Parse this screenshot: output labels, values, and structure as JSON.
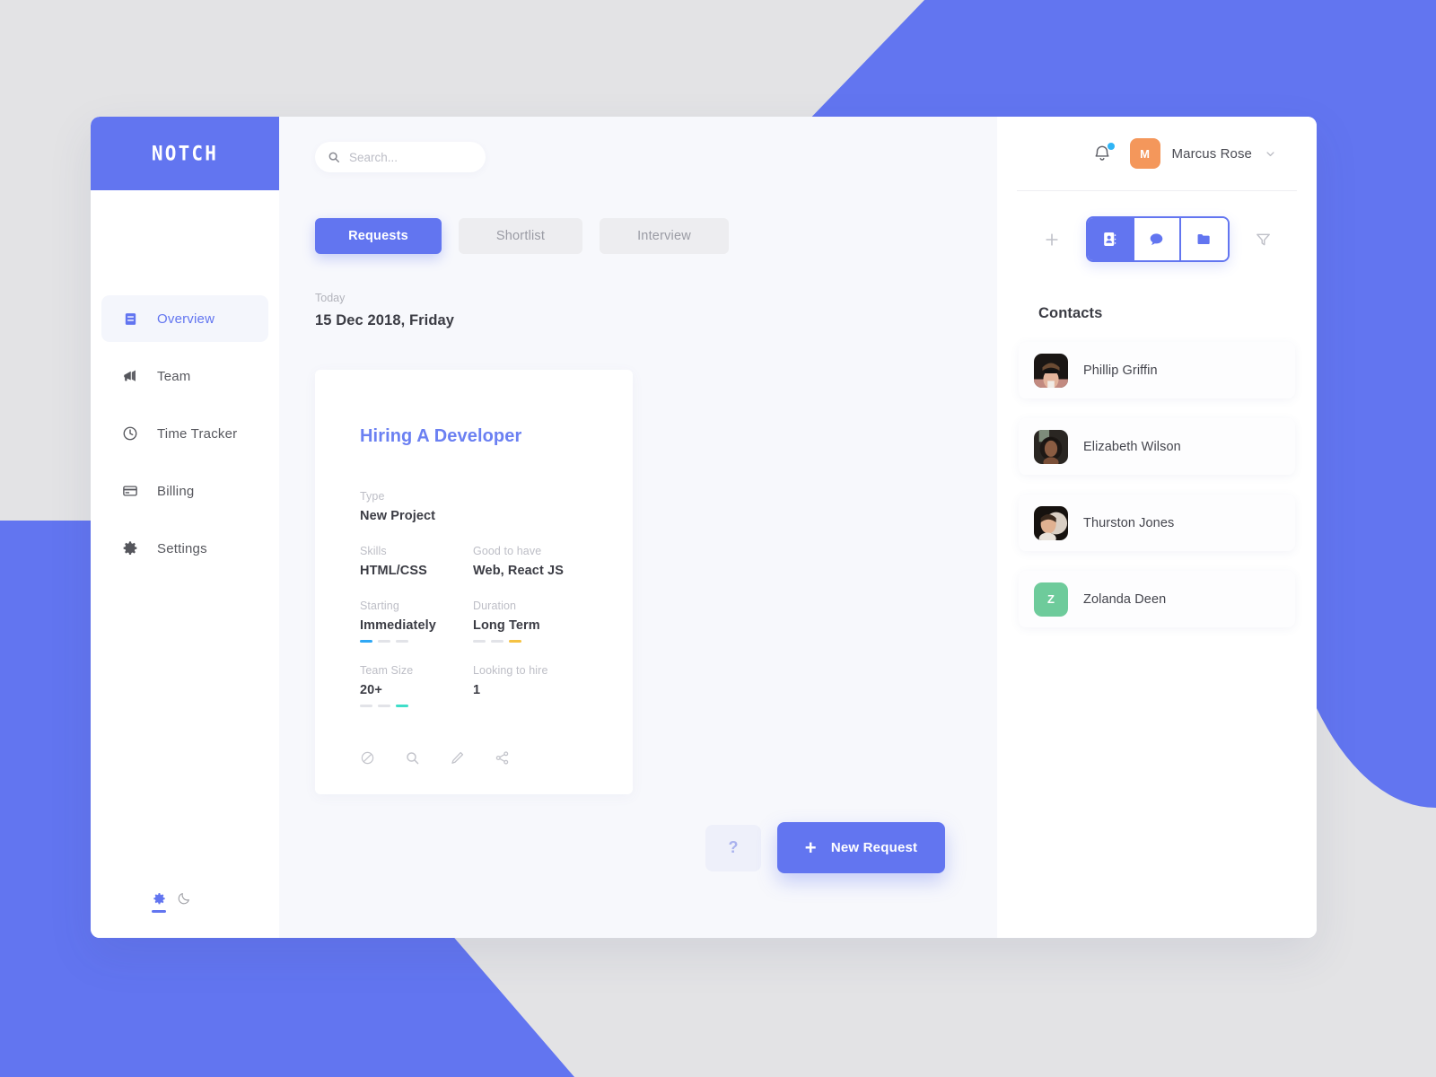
{
  "theme": {
    "accent": "#6275f0",
    "page_bg": "#e3e3e5",
    "main_bg": "#f7f8fc",
    "avatar_orange": "#f4975b",
    "avatar_green": "#6ecb9b",
    "dash_blue": "#2fa8f5",
    "dash_yellow": "#f5c242",
    "dash_teal": "#3fdec9",
    "dash_grey": "#e2e3e8"
  },
  "sidebar": {
    "logo": "NOTCH",
    "items": [
      {
        "label": "Overview",
        "icon": "book-icon",
        "active": true
      },
      {
        "label": "Team",
        "icon": "megaphone-icon",
        "active": false
      },
      {
        "label": "Time Tracker",
        "icon": "clock-icon",
        "active": false
      },
      {
        "label": "Billing",
        "icon": "credit-card-icon",
        "active": false
      },
      {
        "label": "Settings",
        "icon": "gear-icon",
        "active": false
      }
    ],
    "footer": [
      {
        "icon": "gear-icon",
        "active": true
      },
      {
        "icon": "moon-icon",
        "active": false
      }
    ]
  },
  "search": {
    "placeholder": "Search...",
    "value": "",
    "icon": "search-icon"
  },
  "tabs": [
    {
      "label": "Requests",
      "active": true
    },
    {
      "label": "Shortlist",
      "active": false
    },
    {
      "label": "Interview",
      "active": false
    }
  ],
  "date_block": {
    "today_label": "Today",
    "date": "15 Dec 2018, Friday"
  },
  "request_card": {
    "title": "Hiring A Developer",
    "fields": [
      [
        {
          "label": "Type",
          "value": "New Project",
          "dashes": null
        }
      ],
      [
        {
          "label": "Skills",
          "value": "HTML/CSS",
          "dashes": null
        },
        {
          "label": "Good to have",
          "value": "Web, React JS",
          "dashes": null
        }
      ],
      [
        {
          "label": "Starting",
          "value": "Immediately",
          "dashes": [
            "#2fa8f5",
            "#e2e3e8",
            "#e2e3e8"
          ]
        },
        {
          "label": "Duration",
          "value": "Long Term",
          "dashes": [
            "#e2e3e8",
            "#e2e3e8",
            "#f5c242"
          ]
        }
      ],
      [
        {
          "label": "Team Size",
          "value": "20+",
          "dashes": [
            "#e2e3e8",
            "#e2e3e8",
            "#3fdec9"
          ]
        },
        {
          "label": "Looking to hire",
          "value": "1",
          "dashes": null
        }
      ]
    ],
    "actions": [
      {
        "icon": "block-icon"
      },
      {
        "icon": "search-icon"
      },
      {
        "icon": "edit-pencil-icon"
      },
      {
        "icon": "share-icon"
      }
    ]
  },
  "bottom_actions": {
    "help_label": "?",
    "new_request_label": "New Request",
    "new_request_plus": "+"
  },
  "right_panel": {
    "notification_icon": "bell-icon",
    "has_notification": true,
    "user": {
      "initial": "M",
      "name": "Marcus Rose",
      "chevron": "chevron-down-icon"
    },
    "add_icon": "plus-icon",
    "filter_icon": "filter-icon",
    "segments": [
      {
        "icon": "contacts-book-icon",
        "active": true
      },
      {
        "icon": "chat-bubble-icon",
        "active": false
      },
      {
        "icon": "folder-icon",
        "active": false
      }
    ],
    "contacts_title": "Contacts",
    "contacts": [
      {
        "name": "Phillip Griffin",
        "avatar_type": "photo",
        "photo": "man-sunglasses"
      },
      {
        "name": "Elizabeth Wilson",
        "avatar_type": "photo",
        "photo": "woman-curly-hair"
      },
      {
        "name": "Thurston Jones",
        "avatar_type": "photo",
        "photo": "man-portrait"
      },
      {
        "name": "Zolanda Deen",
        "avatar_type": "initial",
        "initial": "Z",
        "color": "#6ecb9b"
      }
    ]
  }
}
